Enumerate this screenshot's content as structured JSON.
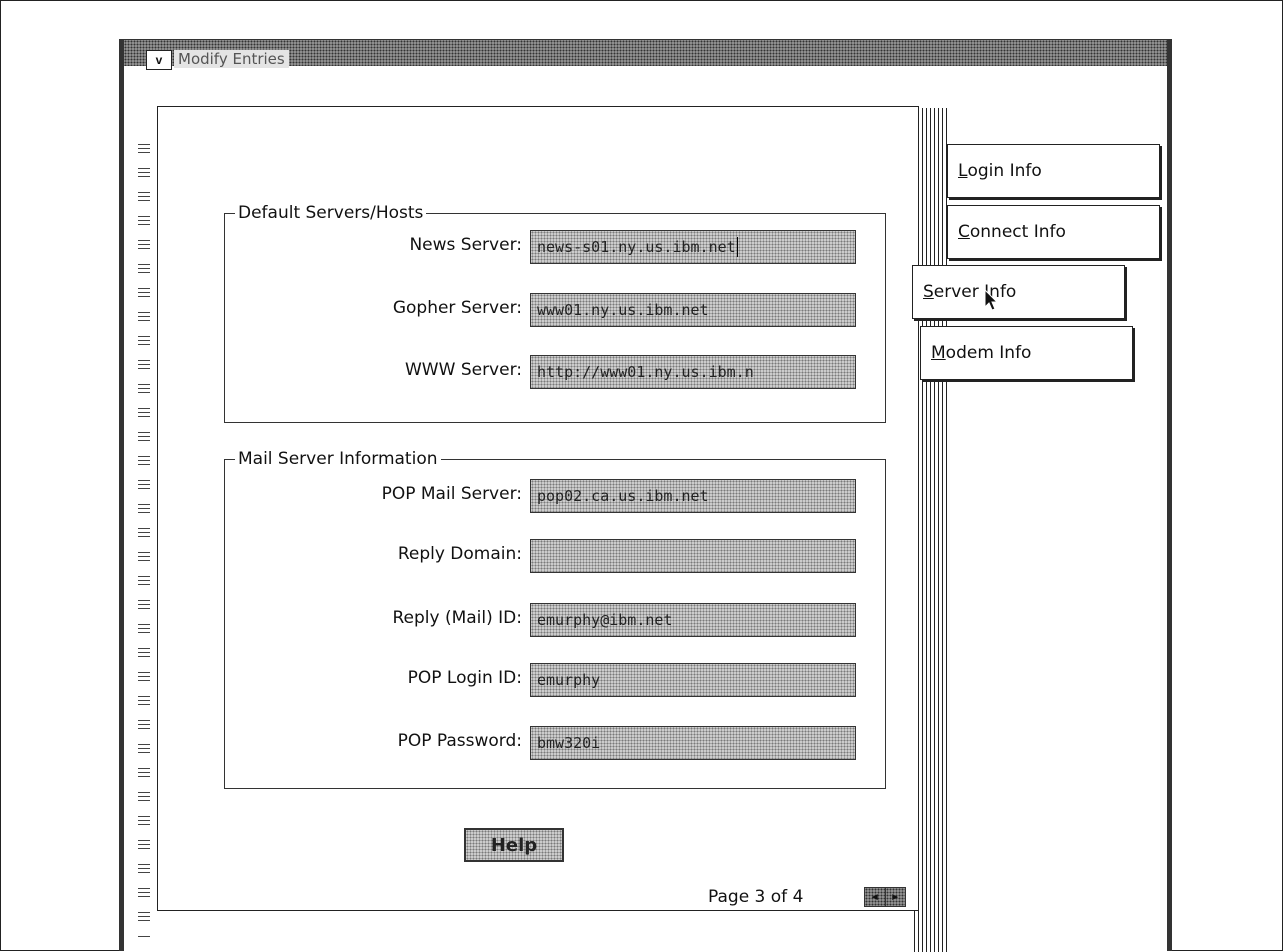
{
  "window": {
    "title": "Modify Entries",
    "sysmenu_glyph": "v"
  },
  "default_servers": {
    "label": "Default Servers/Hosts",
    "news_label": "News Server:",
    "news_value": "news-s01.ny.us.ibm.net",
    "gopher_label": "Gopher Server:",
    "gopher_value": "www01.ny.us.ibm.net",
    "www_label": "WWW Server:",
    "www_value": "http://www01.ny.us.ibm.n"
  },
  "mail_servers": {
    "label": "Mail Server Information",
    "pop_label": "POP Mail Server:",
    "pop_value": "pop02.ca.us.ibm.net",
    "domain_label": "Reply Domain:",
    "domain_value": "",
    "reply_id_label": "Reply (Mail) ID:",
    "reply_id_value": "emurphy@ibm.net",
    "login_label": "POP Login ID:",
    "login_value": "emurphy",
    "password_label": "POP Password:",
    "password_value": "bmw320i"
  },
  "help_label": "Help",
  "page_indicator": "Page 3 of 4",
  "tabs": [
    {
      "first": "L",
      "rest": "ogin Info",
      "selected": false
    },
    {
      "first": "C",
      "rest": "onnect Info",
      "selected": false
    },
    {
      "first": "S",
      "rest": "erver Info",
      "selected": true
    },
    {
      "first": "M",
      "rest": "odem Info",
      "selected": false
    }
  ],
  "icons": {
    "page_back": "left-arrow-icon",
    "page_forward": "right-arrow-icon",
    "cursor": "mouse-pointer-icon"
  }
}
